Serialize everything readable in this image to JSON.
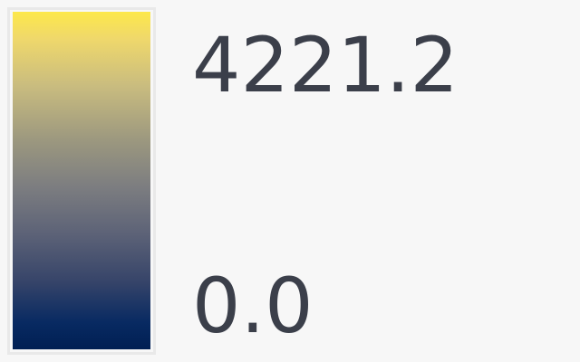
{
  "legend": {
    "max_label": "4221.2",
    "min_label": "0.0",
    "ramp_colors": {
      "top": "#fde84b",
      "middle": "#7c7d80",
      "bottom": "#001f53"
    },
    "background": "#f7f7f7"
  }
}
